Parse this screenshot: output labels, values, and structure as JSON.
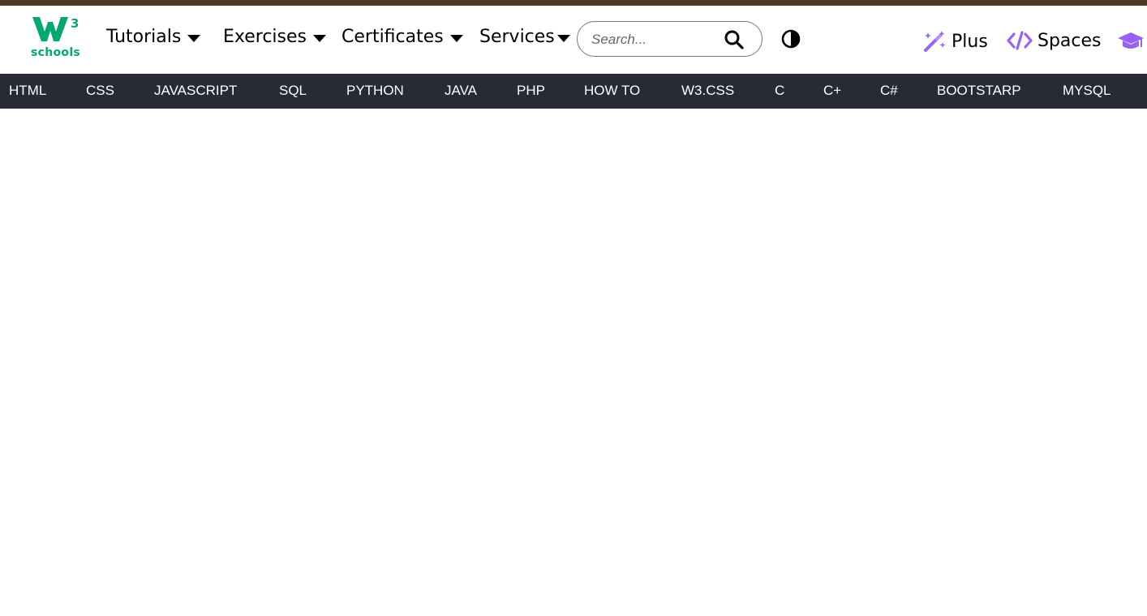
{
  "brand": {
    "superscript": "3",
    "wordmark": "schools",
    "color": "#04aa6d"
  },
  "header": {
    "nav": [
      {
        "label": "Tutorials",
        "icon": "caret-down-icon"
      },
      {
        "label": "Exercises",
        "icon": "caret-down-icon"
      },
      {
        "label": "Certificates",
        "icon": "caret-down-icon"
      },
      {
        "label": "Services",
        "icon": "caret-down-icon"
      }
    ],
    "search": {
      "placeholder": "Search...",
      "value": "",
      "icon": "search-icon"
    },
    "theme_toggle": {
      "icon": "contrast-icon"
    },
    "plus": {
      "label": "Plus",
      "icon": "magic-wand-icon",
      "color": "#9763f6"
    },
    "spaces": {
      "label": "Spaces",
      "icon": "code-icon",
      "color": "#9763f6"
    },
    "academy": {
      "icon": "graduation-cap-icon",
      "color": "#9763f6"
    }
  },
  "topnav": {
    "background": "#282a35",
    "items": [
      "HTML",
      "CSS",
      "JAVASCRIPT",
      "SQL",
      "PYTHON",
      "JAVA",
      "PHP",
      "HOW TO",
      "W3.CSS",
      "C",
      "C+",
      "C#",
      "BOOTSTARP",
      "MYSQL"
    ]
  }
}
